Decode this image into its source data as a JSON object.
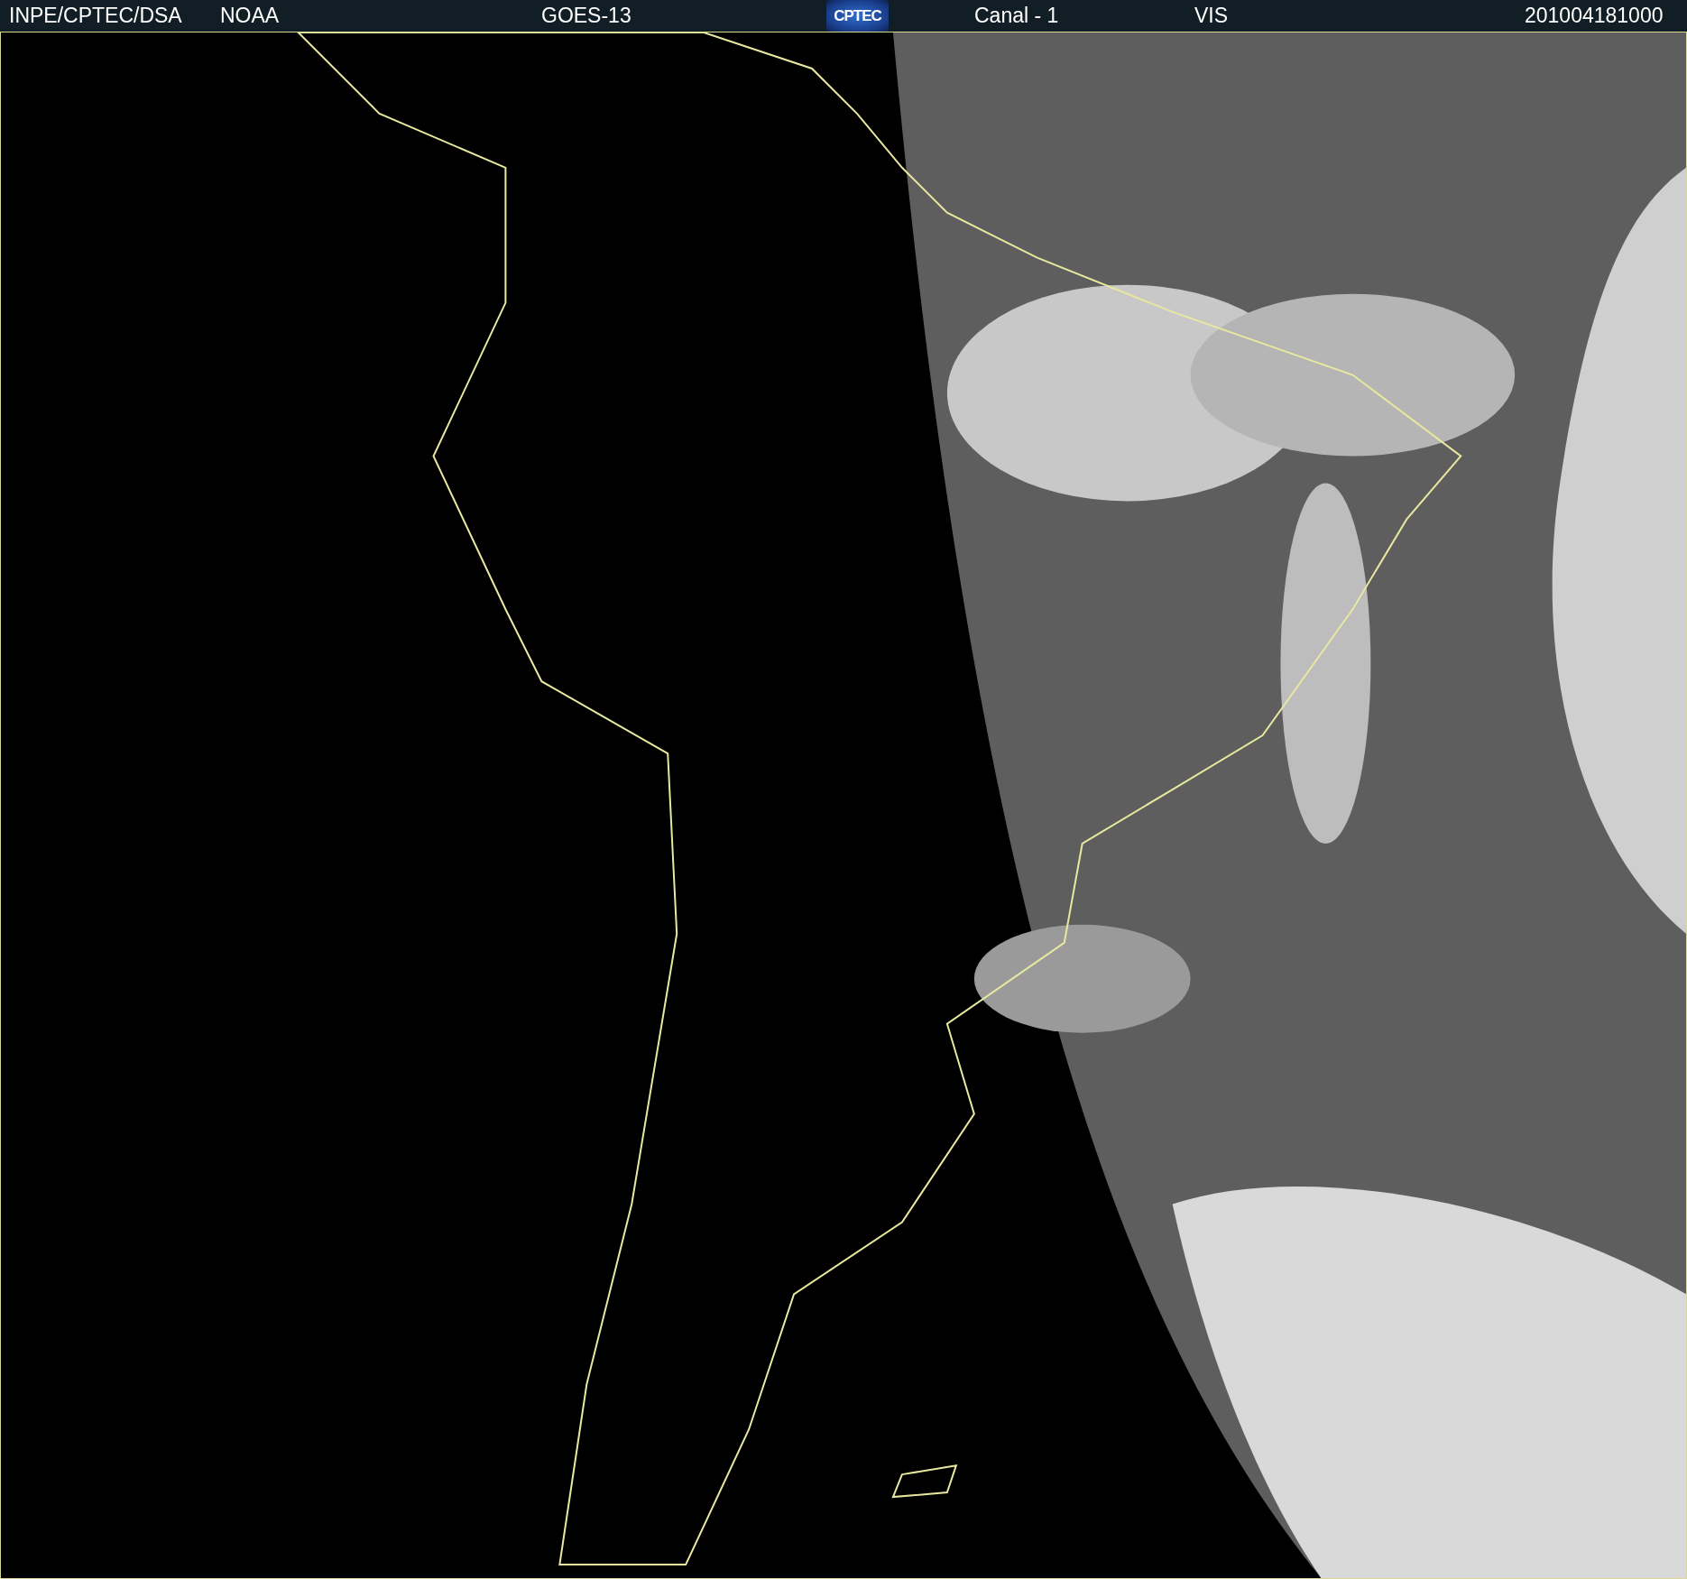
{
  "header": [
    {
      "kind": "text",
      "text": "INPE/CPTEC/DSA"
    },
    {
      "kind": "text",
      "text": "NOAA"
    },
    {
      "kind": "text",
      "text": "GOES-13"
    },
    {
      "kind": "logo",
      "text": "CPTEC"
    },
    {
      "kind": "text",
      "text": "Canal - 1"
    },
    {
      "kind": "text",
      "text": "VIS"
    },
    {
      "kind": "text",
      "text": "201004181000"
    }
  ]
}
